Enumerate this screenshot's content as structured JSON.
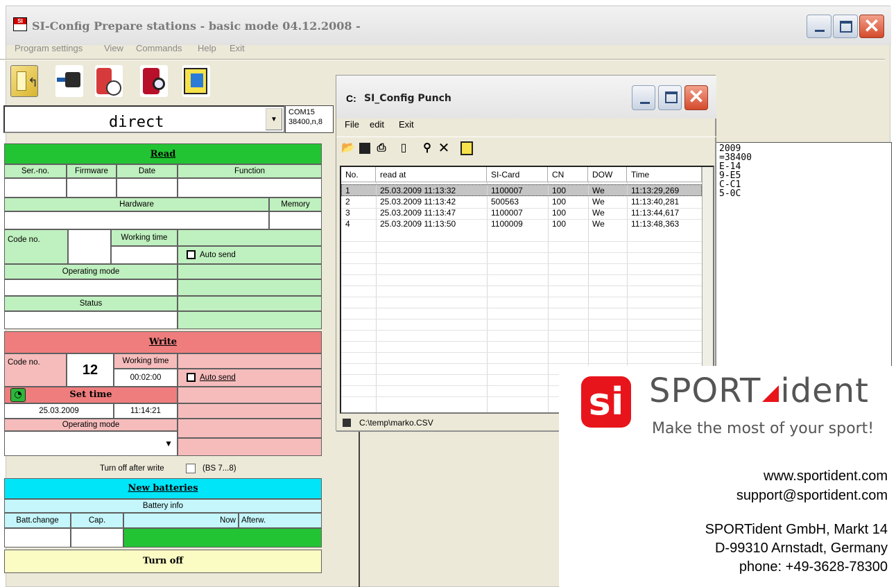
{
  "window": {
    "title": "SI-Config Prepare stations - basic mode 04.12.2008 -",
    "app_icon": "SI"
  },
  "menu": [
    "Program settings",
    "View",
    "Commands",
    "Help",
    "Exit"
  ],
  "toolbar_icons": [
    "folder-station-icon",
    "card-reader-icon",
    "station-clock-icon",
    "station-search-icon",
    "exit-icon"
  ],
  "port": {
    "mode": "direct",
    "com_line1": "COM15",
    "com_line2": "38400,n,8"
  },
  "read": {
    "header": "Read",
    "ser_no_label": "Ser.-no.",
    "firmware_label": "Firmware",
    "date_label": "Date",
    "function_label": "Function",
    "hardware_label": "Hardware",
    "memory_label": "Memory",
    "code_no_label": "Code no.",
    "working_time_label": "Working time",
    "auto_send_label": "Auto send",
    "operating_mode_label": "Operating mode",
    "status_label": "Status"
  },
  "write": {
    "header": "Write",
    "code_no_label": "Code no.",
    "code_no_value": "12",
    "working_time_label": "Working time",
    "working_time_value": "00:02:00",
    "auto_send_label": "Auto send",
    "set_time_label": "Set time",
    "date_value": "25.03.2009",
    "time_value": "11:14:21",
    "operating_mode_label": "Operating mode",
    "turn_off_after_write_label": "Turn off after write",
    "bs_label": "(BS 7...8)"
  },
  "batteries": {
    "header": "New batteries",
    "info_label": "Battery info",
    "batt_change_label": "Batt.change",
    "cap_label": "Cap.",
    "now_label": "Now",
    "afterw_label": "Afterw."
  },
  "turn_off_label": "Turn off",
  "bg_text_lines": [
    "2009",
    "=38400",
    "E-14",
    "9-E5",
    "C-C1",
    "5-0C"
  ],
  "punch_window": {
    "title": "SI_Config Punch",
    "menu": [
      "File",
      "edit",
      "Exit"
    ],
    "toolbar": [
      "open-icon",
      "save-icon",
      "print-icon",
      "new-icon",
      "find-icon",
      "delete-icon",
      "export-icon"
    ],
    "columns": [
      "No.",
      "read at",
      "SI-Card",
      "CN",
      "DOW",
      "Time"
    ],
    "rows": [
      {
        "no": "1",
        "read_at": "25.03.2009 11:13:32",
        "si_card": "1100007",
        "cn": "100",
        "dow": "We",
        "time": "11:13:29,269"
      },
      {
        "no": "2",
        "read_at": "25.03.2009 11:13:42",
        "si_card": "500563",
        "cn": "100",
        "dow": "We",
        "time": "11:13:40,281"
      },
      {
        "no": "3",
        "read_at": "25.03.2009 11:13:47",
        "si_card": "1100007",
        "cn": "100",
        "dow": "We",
        "time": "11:13:44,617"
      },
      {
        "no": "4",
        "read_at": "25.03.2009 11:13:50",
        "si_card": "1100009",
        "cn": "100",
        "dow": "We",
        "time": "11:13:48,363"
      }
    ],
    "status_path": "C:\\temp\\marko.CSV"
  },
  "brand": {
    "logo": "si",
    "name_left": "SPORT",
    "name_right": "ident",
    "tagline": "Make the most of your sport!",
    "website": "www.sportident.com",
    "email": "support@sportident.com",
    "address1": "SPORTident GmbH, Markt 14",
    "address2": "D-99310 Arnstadt, Germany",
    "phone": "phone: +49-3628-78300"
  },
  "colors": {
    "read_header": "#22c433",
    "write_header": "#ef7d7d",
    "batteries_header": "#00e5f8",
    "brand_red": "#e8141b"
  }
}
